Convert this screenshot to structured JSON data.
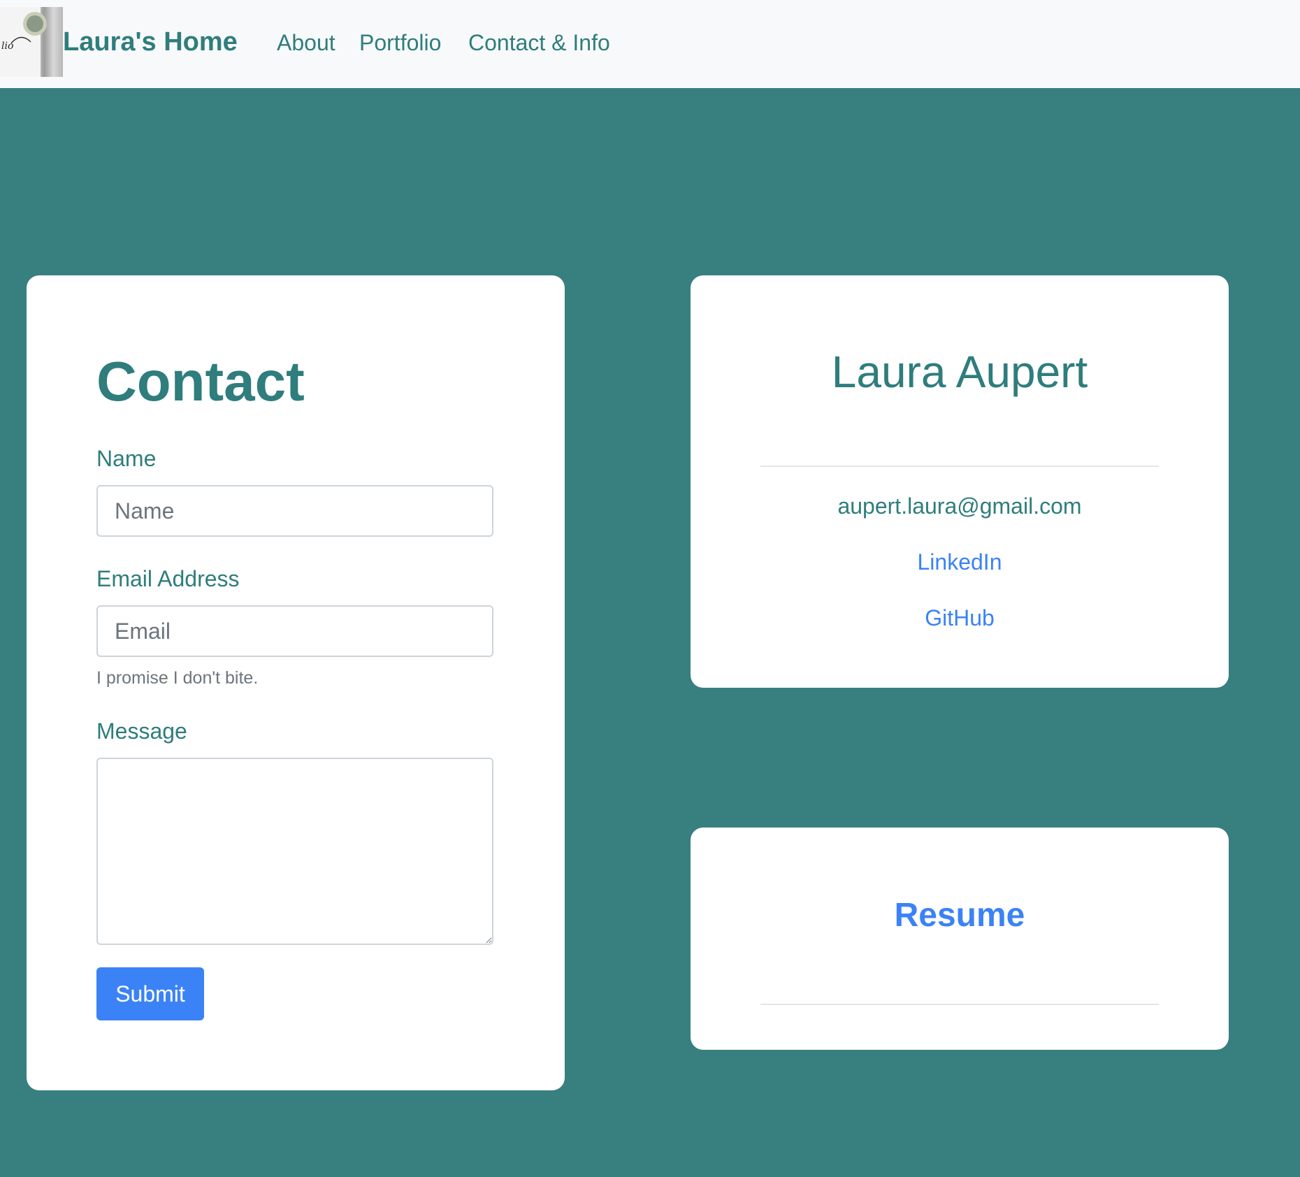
{
  "nav": {
    "brand": "Laura's Home",
    "logo_text": "lio",
    "links": [
      "About",
      "Portfolio",
      "Contact & Info"
    ]
  },
  "contact_form": {
    "title": "Contact",
    "name_label": "Name",
    "name_placeholder": "Name",
    "email_label": "Email Address",
    "email_placeholder": "Email",
    "email_help": "I promise I don't bite.",
    "message_label": "Message",
    "message_value": "",
    "submit_label": "Submit"
  },
  "info": {
    "name": "Laura Aupert",
    "email": "aupert.laura@gmail.com",
    "linkedin_label": "LinkedIn",
    "github_label": "GitHub"
  },
  "resume": {
    "label": "Resume"
  },
  "colors": {
    "background": "#387f80",
    "navbar": "#f8f9fa",
    "teal_text": "#2f7d7d",
    "link_blue": "#3b82f6",
    "card": "#ffffff"
  }
}
